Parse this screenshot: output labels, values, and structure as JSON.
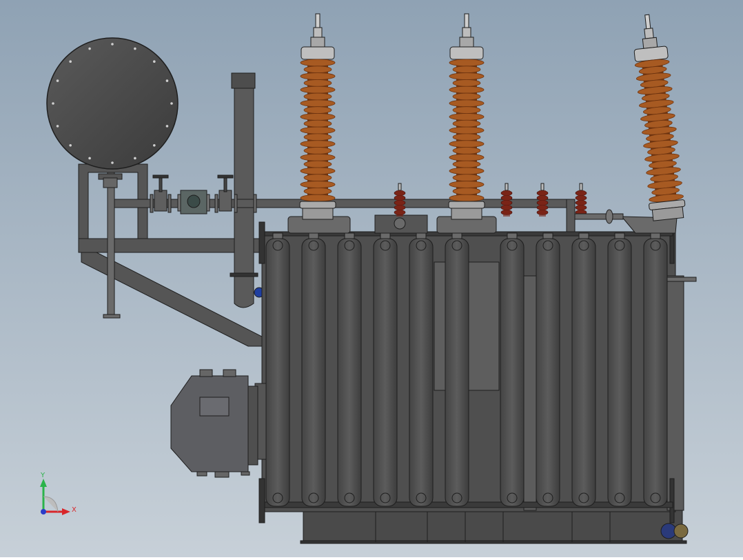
{
  "viewport": {
    "background_top": "#8fa2b4",
    "background_bottom": "#c7d0d8"
  },
  "colors": {
    "tank": "#4f4f4f",
    "tank_light": "#6a6a6a",
    "tank_dark": "#3a3a3a",
    "outline": "#1e1e1e",
    "pipe": "#5a5a5a",
    "insulator": "#a75a22",
    "insulator_dark": "#6e3410",
    "flange": "#bfbfbf",
    "small_bushing": "#7a2418",
    "cabinet": "#5d5e62"
  },
  "triad": {
    "y_label": "Y",
    "x_label": "X",
    "y_color": "#2bb34a",
    "x_color": "#d8262a",
    "z_color": "#2a3cc8"
  }
}
